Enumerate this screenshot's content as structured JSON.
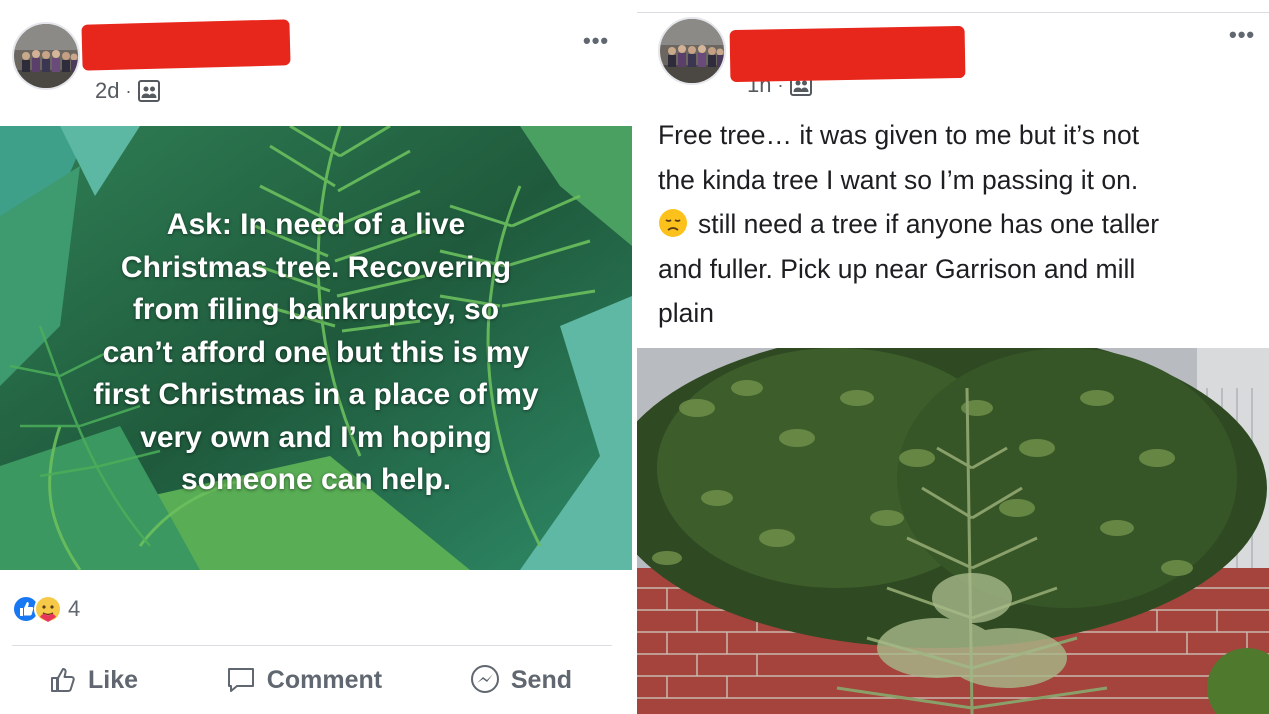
{
  "left_post": {
    "timestamp": "2d",
    "audience_icon": "friends-icon",
    "more_label": "•••",
    "background_text": [
      "Ask: In need of a live",
      "Christmas tree. Recovering",
      "from filing bankruptcy, so",
      "can’t afford one but this is my",
      "first Christmas in a place of my",
      "very own and I’m hoping",
      "someone can help."
    ],
    "reactions": {
      "icons": [
        "like-reaction-icon",
        "care-reaction-icon"
      ],
      "count": "4"
    },
    "actions": {
      "like": "Like",
      "comment": "Comment",
      "send": "Send"
    }
  },
  "right_post": {
    "timestamp": "1h",
    "audience_icon": "friends-icon",
    "more_label": "•••",
    "text_lines": [
      "Free tree… it was given to me but it’s not",
      "the kinda tree I want so I’m passing it on.",
      "still need a tree if anyone has one taller",
      "and fuller. Pick up near Garrison and mill",
      "plain"
    ],
    "emoji": "disappointed-face-icon",
    "photo": "spruce-tree-in-front-of-shrub-and-brick-wall"
  },
  "colors": {
    "redaction": "#e8271c",
    "card_green_dark": "#1f5a3c",
    "card_green_light": "#4a9a5a",
    "like_blue": "#1877f2",
    "muted_text": "#606770"
  }
}
